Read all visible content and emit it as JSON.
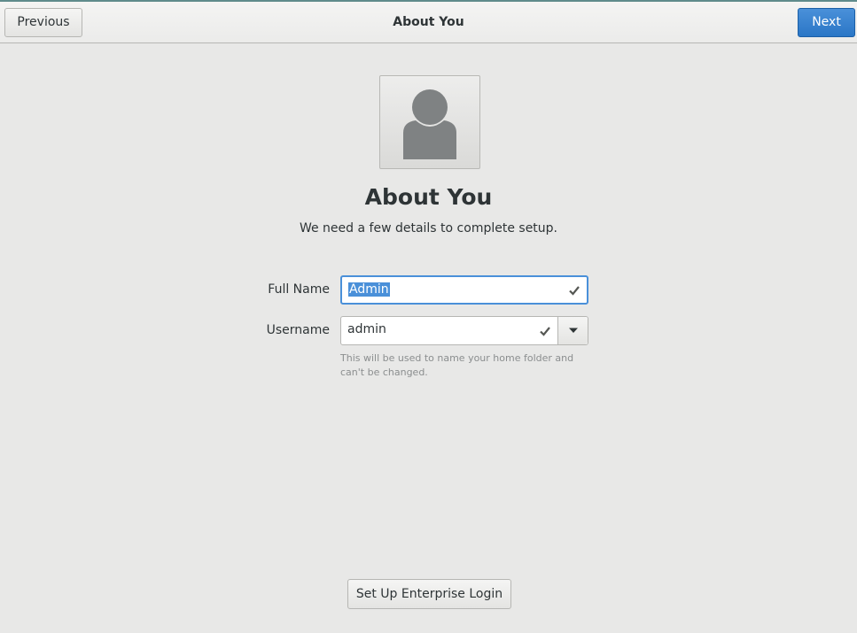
{
  "header": {
    "title": "About You",
    "previous_label": "Previous",
    "next_label": "Next"
  },
  "main": {
    "avatar_icon": "user-avatar-icon",
    "title": "About You",
    "subtitle": "We need a few details to complete setup.",
    "full_name": {
      "label": "Full Name",
      "value": "Admin",
      "selected": true
    },
    "username": {
      "label": "Username",
      "value": "admin",
      "hint": "This will be used to name your home folder and can't be changed."
    }
  },
  "footer": {
    "enterprise_label": "Set Up Enterprise Login"
  },
  "colors": {
    "accent": "#4a90d9",
    "background": "#e8e8e7",
    "text": "#2e3436",
    "hint": "#8b8e8f"
  }
}
